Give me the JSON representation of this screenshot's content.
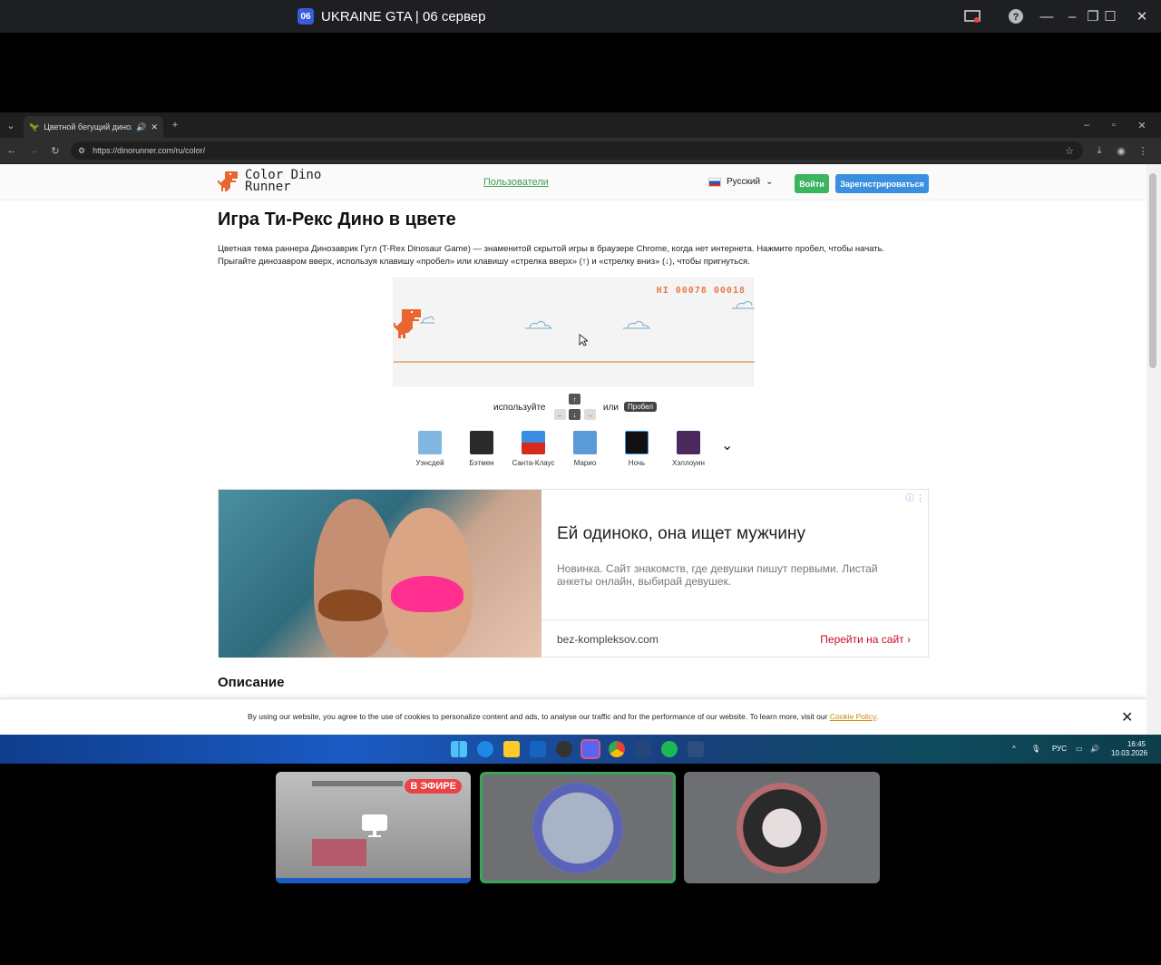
{
  "window": {
    "badge": "06",
    "title": "UKRAINE GTA | 06 сервер"
  },
  "browser": {
    "tab_title": "Цветной бегущий динозавр",
    "url": "https://dinorunner.com/ru/color/"
  },
  "site": {
    "logo_line1": "Color Dino",
    "logo_line2": "Runner",
    "nav_users": "Пользователи",
    "language": "Русский",
    "login": "Войти",
    "register": "Зарегистрироваться",
    "heading": "Игра Ти-Рекс Дино в цвете",
    "intro_line1": "Цветная тема раннера Динозаврик Гугл (T-Rex Dinosaur Game) — знаменитой скрытой игры в браузере Chrome, когда нет интернета. Нажмите пробел, чтобы начать.",
    "intro_line2": "Прыгайте динозавром вверх, используя клавишу «пробел» или клавишу «стрелка вверх» (↑) и «стрелку вниз» (↓), чтобы пригнуться.",
    "game": {
      "hi_label": "HI",
      "hi_score": "00078",
      "score": "00018"
    },
    "controls": {
      "use": "используйте",
      "or": "или",
      "space": "Пробел",
      "up": "↑",
      "down": "↓",
      "left": "←",
      "right": "→"
    },
    "skins": [
      "Уэнсдей",
      "Бэтмен",
      "Санта-Клаус",
      "Марио",
      "Ночь",
      "Хэллоуин"
    ],
    "description_heading": "Описание",
    "cookie_text": "By using our website, you agree to the use of cookies to personalize content and ads, to analyse our traffic and for the performance of our website. To learn more, visit our",
    "cookie_link": "Cookie Policy",
    "cookie_end": "."
  },
  "ad": {
    "title": "Ей одиноко, она ищет мужчину",
    "desc": "Новинка. Сайт знакомств, где девушки пишут первыми. Листай анкеты онлайн, выбирай девушек.",
    "domain": "bez-kompleksov.com",
    "cta": "Перейти на сайт"
  },
  "taskbar": {
    "lang": "РУС",
    "time": "16:45",
    "date": "10.03.2026"
  },
  "tiles": {
    "live": "В ЭФИРЕ"
  },
  "colors": {
    "accent_green": "#3cb55e",
    "accent_blue": "#3b8fe0",
    "dino": "#e8662f",
    "live_red": "#ed4245",
    "speaking_border": "#3ba55c"
  }
}
